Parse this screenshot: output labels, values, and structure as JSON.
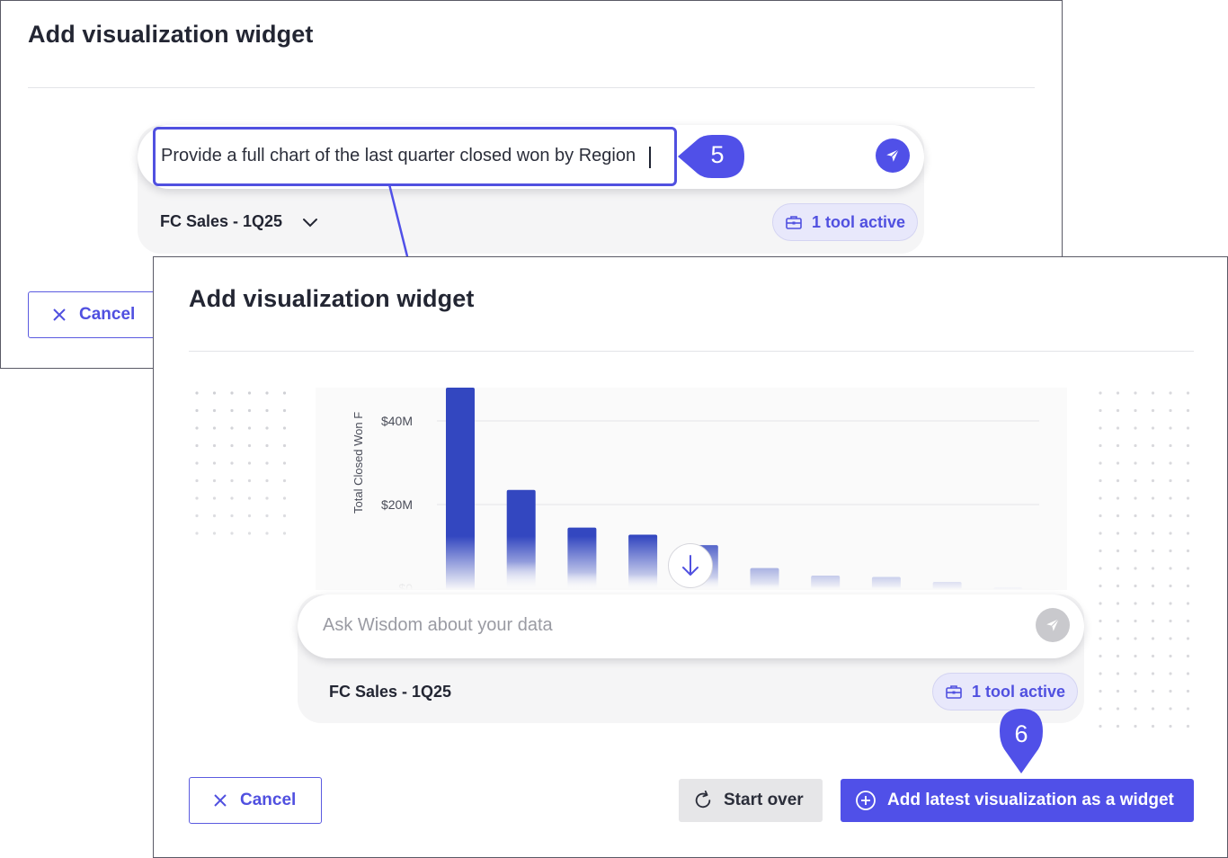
{
  "back_dialog": {
    "title": "Add visualization widget",
    "prompt_text": "Provide a full chart of the last quarter closed won by Region",
    "dataset": "FC Sales - 1Q25",
    "tool_status": "1 tool active",
    "cancel_label": "Cancel"
  },
  "callouts": {
    "step5": "5",
    "step6": "6"
  },
  "front_dialog": {
    "title": "Add visualization widget",
    "ask_placeholder": "Ask Wisdom about your data",
    "dataset": "FC Sales - 1Q25",
    "tool_status": "1 tool active",
    "cancel_label": "Cancel",
    "start_over_label": "Start over",
    "add_widget_label": "Add latest visualization as a widget"
  },
  "chart_data": {
    "type": "bar",
    "ylabel": "Total Closed Won F",
    "yticks": [
      "$40M",
      "$20M",
      "$0"
    ],
    "ytick_values": [
      40,
      20,
      0
    ],
    "ylim": [
      0,
      50
    ],
    "values": [
      48.5,
      23.5,
      14.5,
      12.8,
      10.3,
      4.8,
      3.0,
      2.7,
      1.5,
      0.2
    ],
    "bar_color": "#3347c0",
    "grid": true
  },
  "colors": {
    "accent": "#5050e8",
    "title": "#232633",
    "pill_bg": "#e8e8fb"
  },
  "icons": {
    "send": "send-icon",
    "chevron": "chevron-down-icon",
    "toolbox": "toolbox-icon",
    "close": "close-icon",
    "refresh": "refresh-icon",
    "plus_circle": "plus-circle-icon",
    "arrow_down": "arrow-down-icon"
  }
}
